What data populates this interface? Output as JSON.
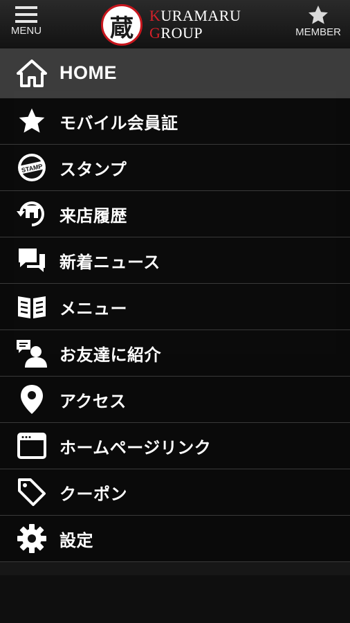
{
  "header": {
    "menu_label": "MENU",
    "member_label": "MEMBER",
    "logo_kanji": "蔵",
    "brand_line1_initial": "K",
    "brand_line1_rest": "URAMARU",
    "brand_line2_initial": "G",
    "brand_line2_rest": "ROUP"
  },
  "drawer": {
    "items": [
      {
        "label": "HOME",
        "icon": "home-icon"
      },
      {
        "label": "モバイル会員証",
        "icon": "star-icon"
      },
      {
        "label": "スタンプ",
        "icon": "stamp-icon"
      },
      {
        "label": "来店履歴",
        "icon": "visit-history-icon"
      },
      {
        "label": "新着ニュース",
        "icon": "news-chat-icon"
      },
      {
        "label": "メニュー",
        "icon": "menu-book-icon"
      },
      {
        "label": "お友達に紹介",
        "icon": "refer-friend-icon"
      },
      {
        "label": "アクセス",
        "icon": "location-pin-icon"
      },
      {
        "label": "ホームページリンク",
        "icon": "browser-window-icon"
      },
      {
        "label": "クーポン",
        "icon": "coupon-tag-icon"
      },
      {
        "label": "設定",
        "icon": "settings-gear-icon"
      }
    ]
  },
  "colors": {
    "accent_red": "#d6212a",
    "header_bg": "#1e1e1e",
    "drawer_bg": "#0a0a0a",
    "active_item_bg": "#3e3e3e"
  }
}
